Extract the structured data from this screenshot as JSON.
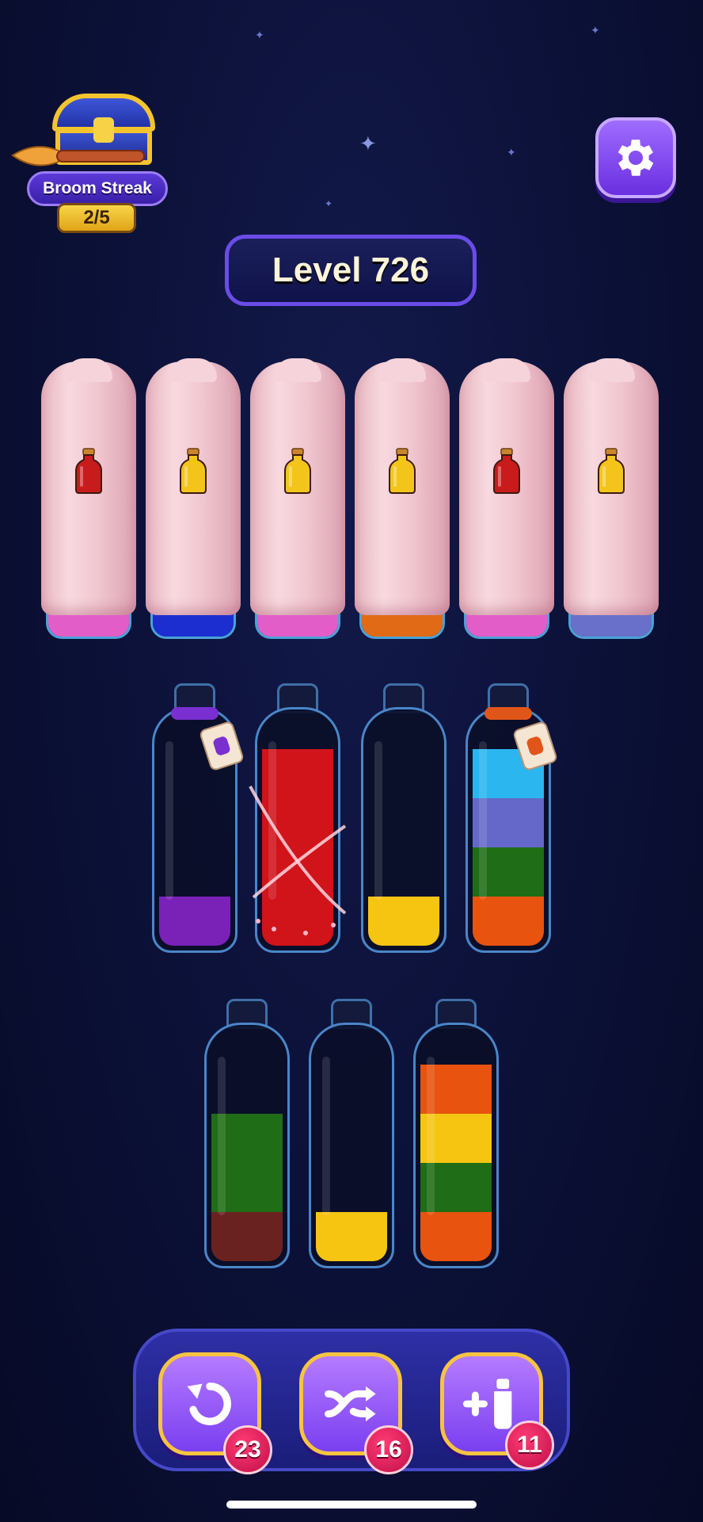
{
  "broom_streak": {
    "label": "Broom Streak",
    "count": "2/5"
  },
  "level": {
    "label": "Level 726"
  },
  "covered_bottles": [
    {
      "potion_color": "#c81b1b",
      "base_color": "#e35dc9"
    },
    {
      "potion_color": "#f3c51b",
      "base_color": "#1c2ecf"
    },
    {
      "potion_color": "#f3c51b",
      "base_color": "#e35dc9"
    },
    {
      "potion_color": "#f3c51b",
      "base_color": "#e06a15"
    },
    {
      "potion_color": "#c81b1b",
      "base_color": "#e35dc9"
    },
    {
      "potion_color": "#f3c51b",
      "base_color": "#6870c9"
    }
  ],
  "bottles_row1": [
    {
      "segments": [
        "#7a22b8"
      ],
      "tag": "purple"
    },
    {
      "segments": [
        "#d0141a",
        "#d0141a",
        "#d0141a",
        "#d0141a"
      ],
      "sparkle": true
    },
    {
      "segments": [
        "#f6c512"
      ]
    },
    {
      "segments": [
        "#e8530f",
        "#1f6d16",
        "#6568c8",
        "#2bb6ef"
      ],
      "tag": "orange"
    }
  ],
  "bottles_row2": [
    {
      "segments": [
        "#6a2220",
        "#1f6d16",
        "#1f6d16"
      ]
    },
    {
      "segments": [
        "#f6c512"
      ]
    },
    {
      "segments": [
        "#e8530f",
        "#1f6d16",
        "#f6c512",
        "#e8530f"
      ]
    }
  ],
  "toolbar": {
    "undo_count": "23",
    "shuffle_count": "16",
    "add_bottle_count": "11"
  },
  "colors": {
    "background": "#0b1036",
    "accent_purple": "#7a3ff0",
    "accent_gold": "#f6c441"
  }
}
